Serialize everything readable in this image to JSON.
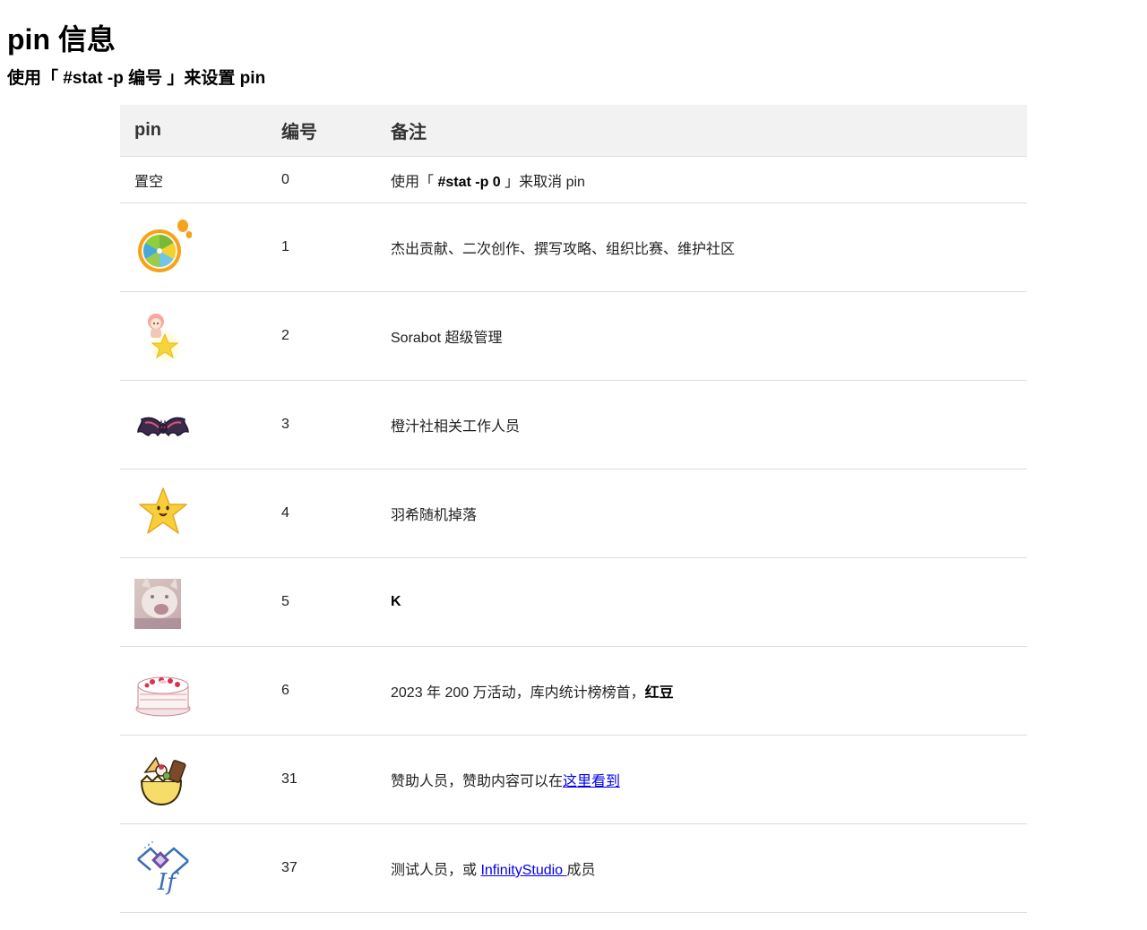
{
  "page": {
    "title": "pin 信息",
    "subtitle": "使用「 #stat -p 编号 」来设置 pin"
  },
  "table": {
    "headers": {
      "pin": "pin",
      "number": "编号",
      "note": "备注"
    },
    "rows": [
      {
        "pin_text": "置空",
        "number": "0",
        "note_pre": "使用「 ",
        "note_bold": "#stat -p 0",
        "note_post": " 」来取消 pin"
      },
      {
        "icon": "orange-slice-icon",
        "number": "1",
        "note": "杰出贡献、二次创作、撰写攻略、组织比赛、维护社区"
      },
      {
        "icon": "anime-character-star-icon",
        "number": "2",
        "note": "Sorabot 超级管理"
      },
      {
        "icon": "bat-icon",
        "number": "3",
        "note": "橙汁社相关工作人员"
      },
      {
        "icon": "smiling-star-icon",
        "number": "4",
        "note": "羽希随机掉落"
      },
      {
        "icon": "cat-photo-icon",
        "number": "5",
        "note_bold": "K"
      },
      {
        "icon": "cake-icon",
        "number": "6",
        "note_pre": "2023 年 200 万活动，库内统计榜榜首，",
        "note_bold": "红豆"
      },
      {
        "icon": "egg-sweets-icon",
        "number": "31",
        "note_pre": "赞助人员，赞助内容可以在",
        "note_link": "这里看到"
      },
      {
        "icon": "infinity-studio-logo-icon",
        "number": "37",
        "note_pre": "测试人员，或 ",
        "note_link": "InfinityStudio ",
        "note_post": "成员"
      }
    ]
  }
}
